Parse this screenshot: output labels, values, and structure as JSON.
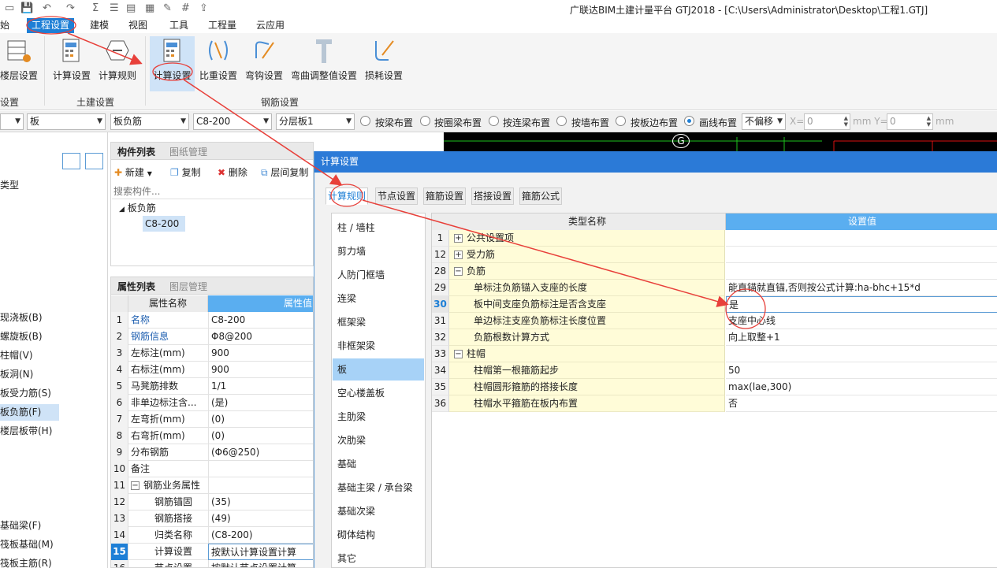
{
  "title_bar": {
    "app_title": "广联达BIM土建计量平台 GTJ2018 - [C:\\Users\\Administrator\\Desktop\\工程1.GTJ]",
    "quick_access": [
      "save-icon",
      "undo-icon",
      "redo-icon",
      "sum-icon",
      "checklist-icon",
      "edit-icon",
      "grid-icon",
      "export-icon"
    ]
  },
  "menu": {
    "tabs": [
      "始",
      "工程设置",
      "建模",
      "视图",
      "工具",
      "工程量",
      "云应用"
    ],
    "active": "工程设置"
  },
  "ribbon": {
    "buttons": [
      {
        "label": "楼层设置",
        "icon": "floor-settings-icon"
      },
      {
        "label": "计算设置",
        "icon": "calc-settings-icon"
      },
      {
        "label": "计算规则",
        "icon": "calc-rules-icon"
      },
      {
        "label": "计算设置",
        "icon": "rebar-calc-settings-icon"
      },
      {
        "label": "比重设置",
        "icon": "weight-settings-icon"
      },
      {
        "label": "弯钩设置",
        "icon": "hook-settings-icon"
      },
      {
        "label": "弯曲调整值设置",
        "icon": "bend-adjust-icon"
      },
      {
        "label": "损耗设置",
        "icon": "loss-settings-icon"
      }
    ],
    "groups": [
      "设置",
      "土建设置",
      "钢筋设置"
    ]
  },
  "toolbar": {
    "combo1": "",
    "combo2": "板",
    "combo3": "板负筋",
    "combo4": "C8-200",
    "combo5": "分层板1",
    "radios": [
      "按梁布置",
      "按圈梁布置",
      "按连梁布置",
      "按墙布置",
      "按板边布置",
      "画线布置"
    ],
    "selected_radio": "画线布置",
    "offset_mode": "不偏移",
    "x_label": "X=",
    "x_value": "0",
    "y_label": "mm Y=",
    "y_value": "0",
    "mm_label": "mm"
  },
  "left_nav": {
    "items": [
      "类型",
      "现浇板(B)",
      "螺旋板(B)",
      "柱帽(V)",
      "板洞(N)",
      "板受力筋(S)",
      "板负筋(F)",
      "楼层板带(H)",
      "基础梁(F)",
      "筏板基础(M)",
      "筏板主筋(R)"
    ],
    "selected": "板负筋(F)"
  },
  "component_panel": {
    "tabs": [
      "构件列表",
      "图纸管理"
    ],
    "tools": [
      "新建",
      "复制",
      "删除",
      "层间复制"
    ],
    "search_placeholder": "搜索构件...",
    "tree_root": "板负筋",
    "tree_leaf": "C8-200"
  },
  "property_panel": {
    "tabs": [
      "属性列表",
      "图层管理"
    ],
    "headers": [
      "属性名称",
      "属性值"
    ],
    "rows": [
      {
        "n": "1",
        "name": "名称",
        "value": "C8-200",
        "blue": true
      },
      {
        "n": "2",
        "name": "钢筋信息",
        "value": "Φ8@200",
        "blue": true
      },
      {
        "n": "3",
        "name": "左标注(mm)",
        "value": "900"
      },
      {
        "n": "4",
        "name": "右标注(mm)",
        "value": "900"
      },
      {
        "n": "5",
        "name": "马凳筋排数",
        "value": "1/1"
      },
      {
        "n": "6",
        "name": "非单边标注含...",
        "value": "(是)"
      },
      {
        "n": "7",
        "name": "左弯折(mm)",
        "value": "(0)"
      },
      {
        "n": "8",
        "name": "右弯折(mm)",
        "value": "(0)"
      },
      {
        "n": "9",
        "name": "分布钢筋",
        "value": "(Φ6@250)"
      },
      {
        "n": "10",
        "name": "备注",
        "value": ""
      },
      {
        "n": "11",
        "name": "钢筋业务属性",
        "value": "",
        "group": true
      },
      {
        "n": "12",
        "name": "钢筋锚固",
        "value": "(35)",
        "indent": true
      },
      {
        "n": "13",
        "name": "钢筋搭接",
        "value": "(49)",
        "indent": true
      },
      {
        "n": "14",
        "name": "归类名称",
        "value": "(C8-200)",
        "indent": true
      },
      {
        "n": "15",
        "name": "计算设置",
        "value": "按默认计算设置计算",
        "indent": true,
        "selected": true
      },
      {
        "n": "16",
        "name": "节点设置",
        "value": "按默认节点设置计算",
        "indent": true
      }
    ]
  },
  "dialog": {
    "title": "计算设置",
    "tabs": [
      "计算规则",
      "节点设置",
      "箍筋设置",
      "搭接设置",
      "箍筋公式"
    ],
    "active_tab": "计算规则",
    "categories": [
      "柱 / 墙柱",
      "剪力墙",
      "人防门框墙",
      "连梁",
      "框架梁",
      "非框架梁",
      "板",
      "空心楼盖板",
      "主肋梁",
      "次肋梁",
      "基础",
      "基础主梁 / 承台梁",
      "基础次梁",
      "砌体结构",
      "其它"
    ],
    "selected_category": "板",
    "table_headers": [
      "类型名称",
      "设置值"
    ],
    "rows": [
      {
        "n": "1",
        "name": "公共设置项",
        "value": "",
        "group": "collapsed"
      },
      {
        "n": "12",
        "name": "受力筋",
        "value": "",
        "group": "collapsed"
      },
      {
        "n": "28",
        "name": "负筋",
        "value": "",
        "group": "expanded"
      },
      {
        "n": "29",
        "name": "单标注负筋锚入支座的长度",
        "value": "能直锚就直锚,否则按公式计算:ha-bhc+15*d"
      },
      {
        "n": "30",
        "name": "板中间支座负筋标注是否含支座",
        "value": "是",
        "selected": true
      },
      {
        "n": "31",
        "name": "单边标注支座负筋标注长度位置",
        "value": "支座中心线"
      },
      {
        "n": "32",
        "name": "负筋根数计算方式",
        "value": "向上取整+1"
      },
      {
        "n": "33",
        "name": "柱帽",
        "value": "",
        "group": "expanded"
      },
      {
        "n": "34",
        "name": "柱帽第一根箍筋起步",
        "value": "50"
      },
      {
        "n": "35",
        "name": "柱帽圆形箍筋的搭接长度",
        "value": "max(lae,300)"
      },
      {
        "n": "36",
        "name": "柱帽水平箍筋在板内布置",
        "value": "否"
      }
    ]
  },
  "canvas": {
    "axis_label": "G"
  },
  "colors": {
    "accent": "#1e7fd6",
    "annotation": "#e8403a",
    "header_blue": "#5aaef0",
    "row_yellow": "#fffcd8"
  }
}
